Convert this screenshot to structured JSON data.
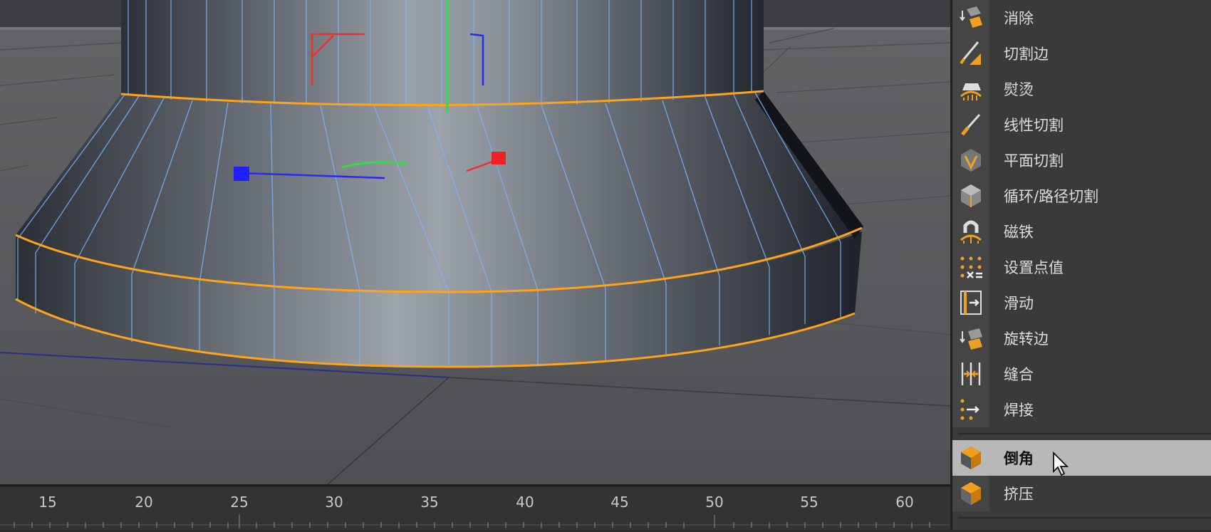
{
  "viewport": {
    "scene": "polygon-pedestal-model"
  },
  "timeline": {
    "ticks": [
      "15",
      "20",
      "25",
      "30",
      "35",
      "40",
      "45",
      "50",
      "55",
      "60"
    ]
  },
  "menu": {
    "items": [
      {
        "label": "消除",
        "icon": "dissolve-icon"
      },
      {
        "label": "切割边",
        "icon": "knife-edge-icon"
      },
      {
        "label": "熨烫",
        "icon": "iron-icon"
      },
      {
        "label": "线性切割",
        "icon": "line-cut-icon"
      },
      {
        "label": "平面切割",
        "icon": "plane-cut-icon"
      },
      {
        "label": "循环/路径切割",
        "icon": "loop-cut-icon"
      },
      {
        "label": "磁铁",
        "icon": "magnet-icon"
      },
      {
        "label": "设置点值",
        "icon": "set-point-value-icon"
      },
      {
        "label": "滑动",
        "icon": "slide-icon"
      },
      {
        "label": "旋转边",
        "icon": "spin-edge-icon"
      },
      {
        "label": "缝合",
        "icon": "stitch-icon"
      },
      {
        "label": "焊接",
        "icon": "weld-icon"
      }
    ],
    "tools": [
      {
        "label": "倒角",
        "icon": "bevel-icon",
        "highlighted": true
      },
      {
        "label": "挤压",
        "icon": "extrude-icon",
        "highlighted": false
      }
    ]
  },
  "colors": {
    "accent_edge": "#ffa31a",
    "wire": "#7ab4ff",
    "axis_x": "#e53333",
    "axis_y": "#33dd44",
    "axis_z": "#2a2aee",
    "highlight": "#b8b8b8"
  }
}
